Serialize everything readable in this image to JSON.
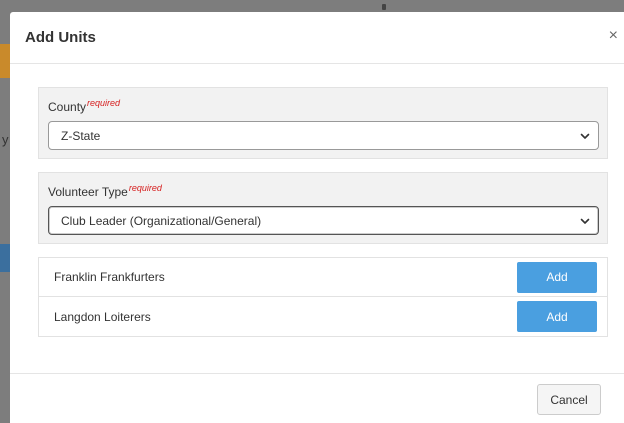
{
  "background": {
    "partial_char": "y"
  },
  "modal": {
    "title": "Add Units",
    "close_label": "×",
    "county": {
      "label": "County",
      "required": "required",
      "selected": "Z-State"
    },
    "volunteer_type": {
      "label": "Volunteer Type",
      "required": "required",
      "selected": "Club Leader (Organizational/General)"
    },
    "units": [
      {
        "name": "Franklin Frankfurters",
        "action": "Add"
      },
      {
        "name": "Langdon Loiterers",
        "action": "Add"
      }
    ],
    "footer": {
      "cancel_label": "Cancel"
    }
  },
  "colors": {
    "accent": "#4a9fe0",
    "required": "#d61f1f",
    "panel_bg": "#f2f2f2",
    "backdrop": "#7d7d7d"
  },
  "icons": {
    "close": "close-icon",
    "dropdown": "chevron-down-icon"
  }
}
